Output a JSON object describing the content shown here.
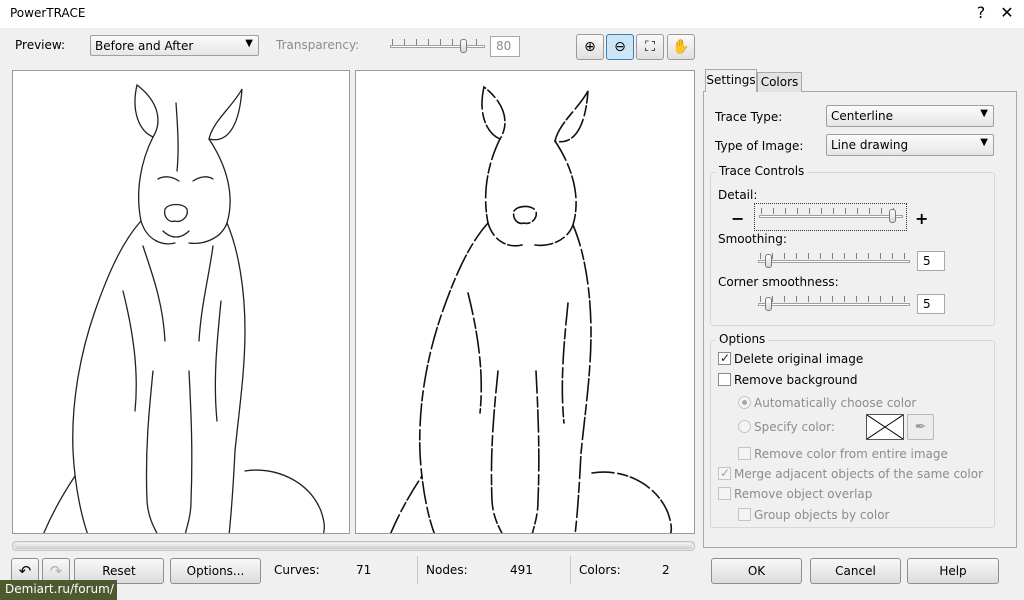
{
  "window": {
    "title": "PowerTRACE",
    "help_glyph": "?",
    "close_glyph": "✕"
  },
  "toolbar": {
    "preview_label": "Preview:",
    "preview_value": "Before and After",
    "transparency_label": "Transparency:",
    "transparency_value": "80",
    "transparency_level": 0.8,
    "tools": [
      {
        "name": "zoom-in-icon",
        "glyph": "⊕"
      },
      {
        "name": "zoom-out-icon",
        "glyph": "⊖"
      },
      {
        "name": "fit-icon",
        "glyph": "⛶"
      },
      {
        "name": "pan-hand-icon",
        "glyph": "✋"
      }
    ]
  },
  "tabs": {
    "settings": "Settings",
    "colors": "Colors"
  },
  "settings": {
    "trace_type_label": "Trace Type:",
    "trace_type_value": "Centerline",
    "image_type_label": "Type of Image:",
    "image_type_value": "Line drawing",
    "trace_controls_title": "Trace Controls",
    "detail_label": "Detail:",
    "detail_level": 0.95,
    "minus_glyph": "−",
    "plus_glyph": "+",
    "smoothing_label": "Smoothing:",
    "smoothing_value": "5",
    "smoothing_level": 0.05,
    "corner_label": "Corner smoothness:",
    "corner_value": "5",
    "corner_level": 0.05
  },
  "options": {
    "title": "Options",
    "delete_original": "Delete original image",
    "remove_background": "Remove background",
    "auto_color": "Automatically choose color",
    "specify_color": "Specify color:",
    "remove_color_entire": "Remove color from entire image",
    "merge_adjacent": "Merge adjacent objects of the same color",
    "remove_overlap": "Remove object overlap",
    "group_by_color": "Group objects by color"
  },
  "status": {
    "reset": "Reset",
    "options": "Options...",
    "curves_label": "Curves:",
    "curves_value": "71",
    "nodes_label": "Nodes:",
    "nodes_value": "491",
    "colors_label": "Colors:",
    "colors_value": "2"
  },
  "buttons": {
    "ok": "OK",
    "cancel": "Cancel",
    "help": "Help"
  },
  "watermark": "Demiart.ru/forum/"
}
